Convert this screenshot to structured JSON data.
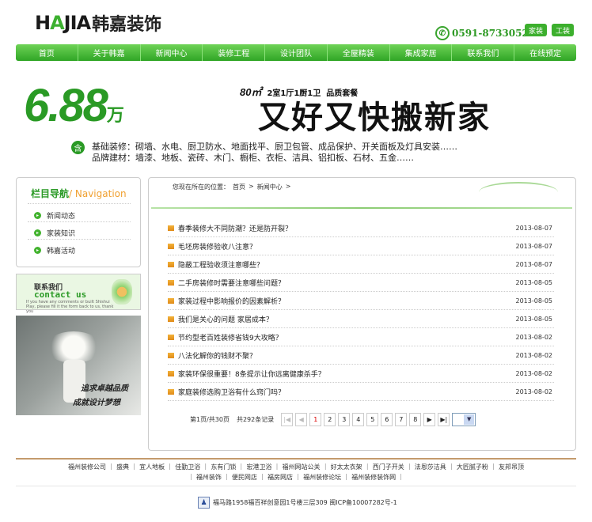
{
  "header": {
    "logo_en_prefix": "H",
    "logo_en_mid": "A",
    "logo_en_suffix": "JIA",
    "logo_cn": "韩嘉装饰",
    "phone": "0591-87330527",
    "btn_home": "家装",
    "btn_office": "工装"
  },
  "nav": [
    "首页",
    "关于韩嘉",
    "新闻中心",
    "装修工程",
    "设计团队",
    "全屋精装",
    "集成家居",
    "联系我们",
    "在线预定"
  ],
  "banner": {
    "price": "6.88",
    "unit": "万",
    "area": "80㎡",
    "layout": "2室1厅1厨1卫",
    "package": "品质套餐",
    "slogan": "又好又快搬新家",
    "badge": "含",
    "line1": "基础装修：砌墙、水电、厨卫防水、地面找平、厨卫包管、成品保护、开关面板及灯具安装……",
    "line2": "品牌建材：墙漆、地板、瓷砖、木门、橱柜、衣柜、洁具、铝扣板、石材、五金……"
  },
  "sidebar": {
    "title_cn": "栏目导航",
    "title_en": "/ Navigation",
    "items": [
      "新闻动态",
      "家装知识",
      "韩嘉活动"
    ],
    "contact_cn": "联系我们",
    "contact_en": "contact us",
    "contact_small": "If you have any comments or built Shishui\nPlay, please fill it the form back to us, thank you",
    "photo_text_1": "追求卓越品质",
    "photo_text_2": "成就设计梦想"
  },
  "breadcrumb": {
    "prefix": "您现在所在的位置：",
    "home": "首页",
    "sep1": ">",
    "current": "新闻中心",
    "sep2": ">"
  },
  "news": [
    {
      "title": "春季装修大不同防潮？还是防开裂？",
      "date": "2013-08-07"
    },
    {
      "title": "毛坯房装修验收八注意？",
      "date": "2013-08-07"
    },
    {
      "title": "隐蔽工程验收须注意哪些？",
      "date": "2013-08-07"
    },
    {
      "title": "二手房装修时需要注意哪些问题？",
      "date": "2013-08-05"
    },
    {
      "title": "家装过程中影响报价的因素解析？",
      "date": "2013-08-05"
    },
    {
      "title": "我们是关心的问题 家居成本？",
      "date": "2013-08-05"
    },
    {
      "title": "节约型老百姓装修省钱9大攻略？",
      "date": "2013-08-02"
    },
    {
      "title": "八法化解你的钱财不聚？",
      "date": "2013-08-02"
    },
    {
      "title": "家装环保很重要！8条提示让你远离健康杀手？",
      "date": "2013-08-02"
    },
    {
      "title": "家庭装修选购卫浴有什么窍门吗？",
      "date": "2013-08-02"
    }
  ],
  "pager": {
    "page_info": "第1页/共30页",
    "total": "共292条记录",
    "first": "|◀",
    "prev": "◀",
    "pages": [
      "1",
      "2",
      "3",
      "4",
      "5",
      "6",
      "7",
      "8"
    ],
    "next": "▶",
    "last": "▶|",
    "select_arrow": "▼"
  },
  "footer": {
    "links1": "福州装修公司 ｜ 盛典 ｜ 宜人地板 ｜ 佳勤卫浴 ｜ 东有门锁 ｜ 宏港卫浴 ｜ 福州网站公关 ｜ 好太太衣架 ｜ 西门子开关 ｜ 法恩莎洁具 ｜ 大匠腻子粉 ｜ 友邦吊顶",
    "links2": "｜ 福州装饰 ｜ 便民网店 ｜ 福房网店 ｜ 福州装修论坛 ｜ 福州装修装饰网 ｜",
    "address": "福马路1958福百祥创意园1号楼三层309  闽ICP备10007282号-1",
    "address_icon": "♟"
  }
}
